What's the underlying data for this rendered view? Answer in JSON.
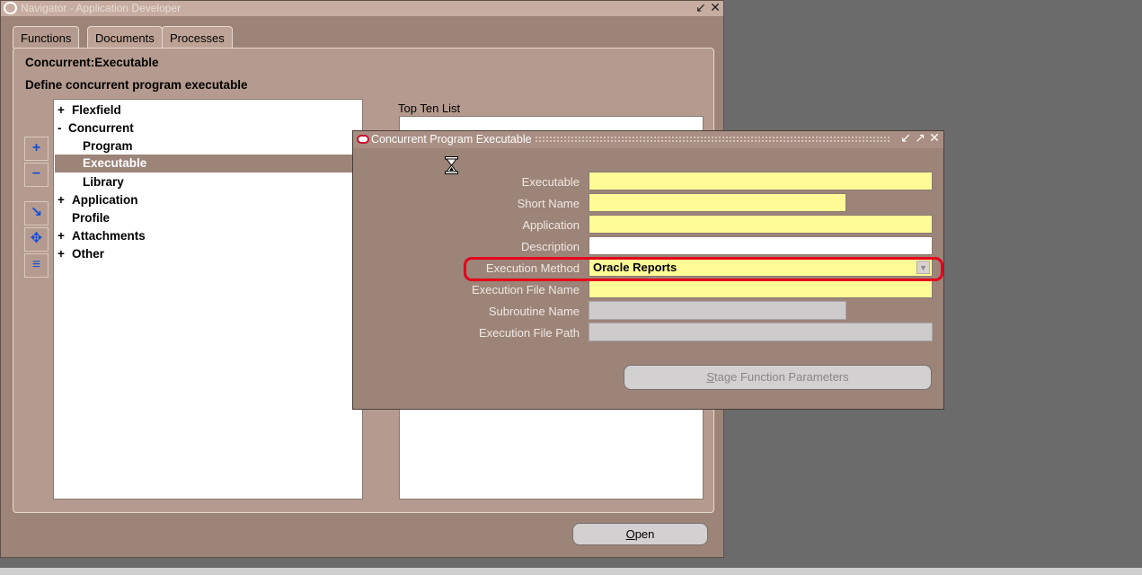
{
  "navigator": {
    "title": "Navigator - Application Developer",
    "tabs": [
      "Functions",
      "Documents",
      "Processes"
    ],
    "function_name": "Concurrent:Executable",
    "function_description": "Define concurrent program executable",
    "tree": [
      {
        "expander": "+",
        "label": "Flexfield"
      },
      {
        "expander": "-",
        "label": "Concurrent"
      },
      {
        "expander": "",
        "label": "Program"
      },
      {
        "expander": "",
        "label": "Executable"
      },
      {
        "expander": "",
        "label": "Library"
      },
      {
        "expander": "+",
        "label": "Application"
      },
      {
        "expander": "",
        "label": "Profile"
      },
      {
        "expander": "+",
        "label": "Attachments"
      },
      {
        "expander": "+",
        "label": "Other"
      }
    ],
    "top_ten_label": "Top Ten List",
    "open_button": "Open",
    "open_mnemonic": "O",
    "open_rest": "pen"
  },
  "cpe": {
    "title": "Concurrent Program Executable",
    "fields": {
      "executable": {
        "label": "Executable",
        "value": ""
      },
      "short_name": {
        "label": "Short Name",
        "value": ""
      },
      "application": {
        "label": "Application",
        "value": ""
      },
      "description": {
        "label": "Description",
        "value": ""
      },
      "execution_method": {
        "label": "Execution Method",
        "value": "Oracle Reports"
      },
      "execution_file_name": {
        "label": "Execution File Name",
        "value": ""
      },
      "subroutine_name": {
        "label": "Subroutine Name",
        "value": ""
      },
      "execution_file_path": {
        "label": "Execution File Path",
        "value": ""
      }
    },
    "stage_button": "Stage Function Parameters",
    "stage_mnemonic": "S",
    "stage_rest": "tage Function Parameters"
  },
  "colors": {
    "window_bg": "#9c8478",
    "required_field": "#fffb97",
    "highlight": "#e5001a"
  },
  "icons": [
    "hourglass-icon",
    "minimize-icon",
    "maximize-icon",
    "close-icon",
    "expand-plus-icon",
    "collapse-minus-icon",
    "oracle-logo-icon"
  ]
}
